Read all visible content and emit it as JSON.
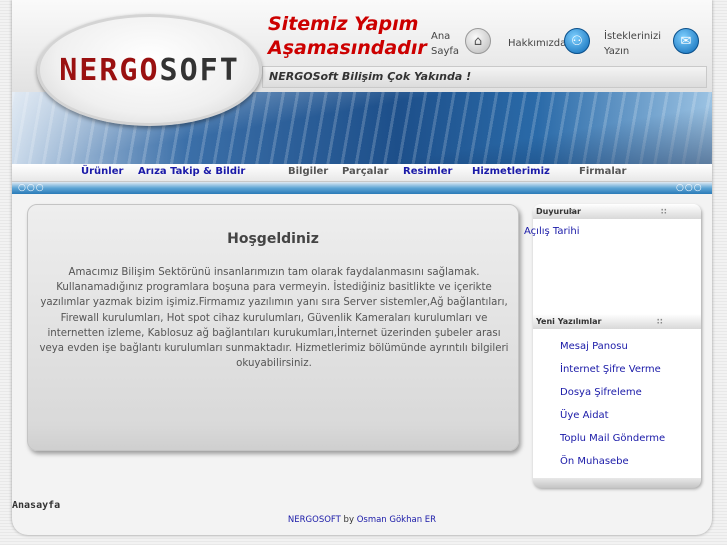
{
  "header": {
    "logo_part1": "NERGO",
    "logo_part2": "SOFT",
    "headline_line1": "Sitemiz Yapım",
    "headline_line2": "Aşamasındadır",
    "slogan": "NERGOSoft Bilişim Çok Yakında !",
    "links": {
      "home_line1": "Ana",
      "home_line2": "Sayfa",
      "about": "Hakkımızda",
      "requests_line1": "İsteklerinizi",
      "requests_line2": "Yazın"
    },
    "icons": [
      "home-icon",
      "people-icon",
      "mail-icon"
    ]
  },
  "nav": {
    "items": [
      "Ürünler",
      "Arıza Takip & Bildir",
      "Bilgiler",
      "Parçalar",
      "Resimler",
      "Hizmetlerimiz",
      "Firmalar"
    ]
  },
  "welcome": {
    "title": "Hoşgeldiniz",
    "body": "Amacımız Bilişim Sektörünü insanlarımızın tam olarak faydalanmasını sağlamak. Kullanamadığınız programlara boşuna para vermeyin. İstediğiniz basitlikte ve içerikte yazılımlar yazmak bizim işimiz.Firmamız yazılımın yanı sıra Server sistemler,Ağ bağlantıları, Firewall kurulumları, Hot spot cihaz kurulumları, Güvenlik Kameraları kurulumları ve internetten izleme, Kablosuz ağ bağlantıları kurukumları,İnternet üzerinden şubeler arası veya evden işe bağlantı kurulumları sunmaktadır. Hizmetlerimiz bölümünde ayrıntılı bilgileri okuyabilirsiniz."
  },
  "announcements": {
    "title": "Duyurular",
    "items": [
      "Açılış Tarihi"
    ]
  },
  "new_software": {
    "title": "Yeni Yazılımlar",
    "items": [
      "Mesaj Panosu",
      "İnternet Şifre Verme",
      "Dosya Şifreleme",
      "Üye Aidat",
      "Toplu Mail Gönderme",
      "Ön Muhasebe"
    ]
  },
  "footer": {
    "label": "Anasayfa",
    "brand": "NERGOSOFT",
    "by": " by ",
    "author": "Osman Gökhan ER"
  },
  "colors": {
    "headline": "#cc0000",
    "link": "#1a1aa8",
    "nav_bar": "#2a7ab8"
  }
}
